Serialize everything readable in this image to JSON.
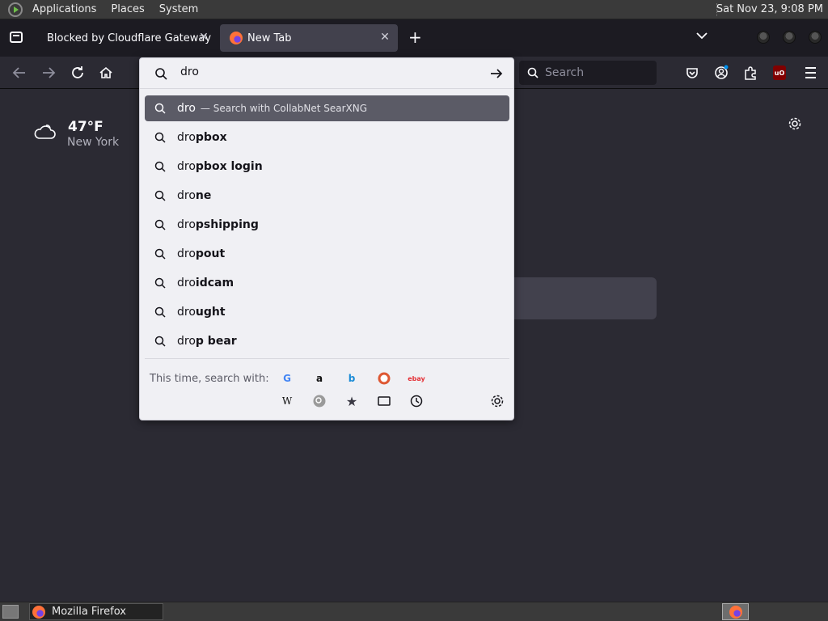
{
  "topbar": {
    "menus": [
      "Applications",
      "Places",
      "System"
    ],
    "clock": "Sat Nov 23,  9:08 PM"
  },
  "tabs": [
    {
      "label": "Blocked by Cloudflare Gateway",
      "active": false
    },
    {
      "label": "New Tab",
      "active": true
    }
  ],
  "navbar": {
    "search_placeholder": "Search"
  },
  "newtab": {
    "weather_temp": "47°F",
    "weather_city": "New York"
  },
  "urlbar": {
    "query": "dro",
    "heuristic": {
      "text": "dro",
      "action": "— Search with CollabNet SearXNG"
    },
    "suggestions": [
      {
        "typed": "dro",
        "completion": "pbox"
      },
      {
        "typed": "dro",
        "completion": "pbox login"
      },
      {
        "typed": "dro",
        "completion": "ne"
      },
      {
        "typed": "dro",
        "completion": "pshipping"
      },
      {
        "typed": "dro",
        "completion": "pout"
      },
      {
        "typed": "dro",
        "completion": "idcam"
      },
      {
        "typed": "dro",
        "completion": "ught"
      },
      {
        "typed": "dro",
        "completion": "p bear"
      }
    ],
    "oneoff_label": "This time, search with:",
    "engines": [
      "google-icon",
      "amazon-icon",
      "bing-icon",
      "duckduckgo-icon",
      "ebay-icon",
      "wikipedia-icon",
      "searxng-icon",
      "bookmarks-icon",
      "tabs-icon",
      "history-icon"
    ]
  },
  "taskbar": {
    "window_label": "Mozilla Firefox"
  },
  "colors": {
    "browser_bg": "#2b2a33",
    "tabstrip_bg": "#1c1b22",
    "dropdown_bg": "#f0f0f4",
    "selected_row": "#5b5b66"
  }
}
